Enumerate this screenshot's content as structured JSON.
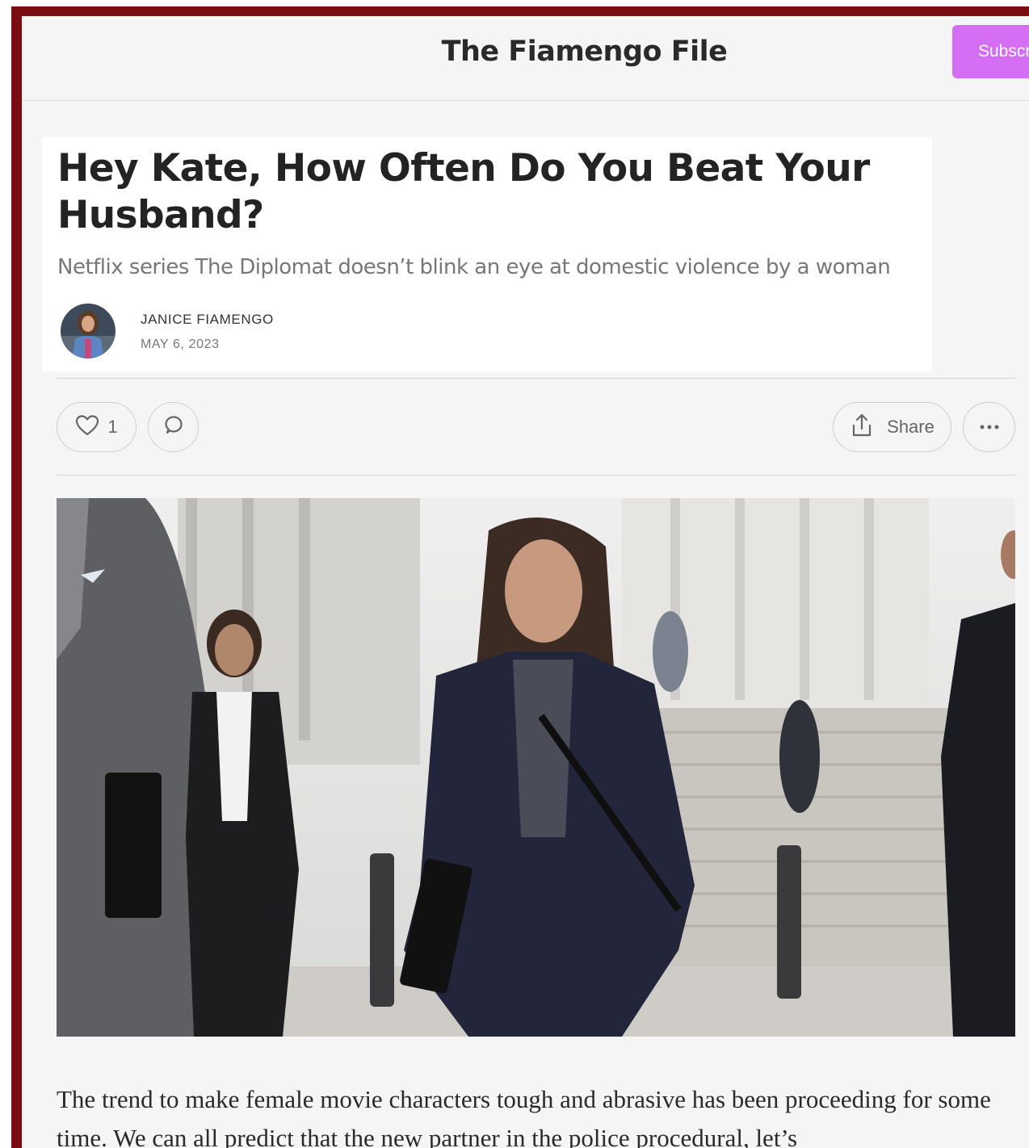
{
  "site": {
    "title": "The Fiamengo File",
    "subscribe_label": "Subscribe"
  },
  "post": {
    "title": "Hey Kate, How Often Do You Beat Your Husband?",
    "subtitle": "Netflix series The Diplomat doesn’t blink an eye at domestic violence by a woman",
    "author": "JANICE FIAMENGO",
    "date": "MAY 6, 2023"
  },
  "actions": {
    "like_count": "1",
    "share_label": "Share"
  },
  "icons": {
    "like": "heart-icon",
    "comment": "comment-icon",
    "share": "share-icon",
    "more": "more-icon"
  },
  "body": {
    "paragraph_1": "The trend to make female movie characters tough and abrasive has been proceeding for some time. We can all predict that the new partner in the police procedural, let’s"
  },
  "colors": {
    "frame_border": "#7a0c12",
    "accent": "#d46ef2",
    "page_background": "#f5f5f5"
  }
}
